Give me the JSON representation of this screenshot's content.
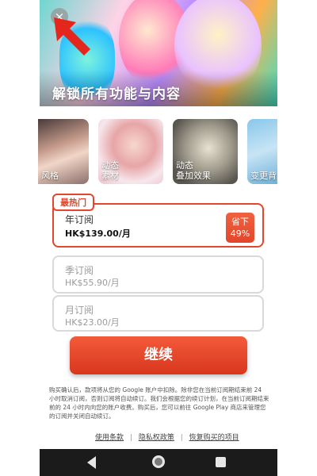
{
  "hero": {
    "title": "解锁所有功能与内容",
    "close_glyph": "×"
  },
  "features": [
    {
      "label": "风格"
    },
    {
      "label": "动态\n素材"
    },
    {
      "label": "动态\n叠加效果"
    },
    {
      "label": "变更背"
    }
  ],
  "plans": {
    "badge": "最热门",
    "annual": {
      "name": "年订阅",
      "price": "HK$139.00/月",
      "save_line1": "省下",
      "save_line2": "49%"
    },
    "quarterly": {
      "name": "季订阅",
      "price": "HK$55.90/月"
    },
    "monthly": {
      "name": "月订阅",
      "price": "HK$23.00/月"
    }
  },
  "continue_label": "继续",
  "terms_text": "购买确认后，款项将从您的 Google 账户中扣除。除非您在当前订阅期结束前 24 小时取消订阅，否则订阅将自动续订。我们会根据您的续订计划，在当前订阅期结束前的 24 小时内向您的账户收费。购买后，您可以前往 Google Play 商店来管理您的订阅并关闭自动续订。",
  "links": {
    "terms": "使用条款",
    "privacy": "隐私权政策",
    "restore": "恢复购买的项目",
    "separator": "|"
  },
  "colors": {
    "accent": "#e2462c",
    "navbar": "#1b1b1b"
  },
  "icons": {
    "close": "close-icon",
    "back": "back-triangle-icon",
    "home": "home-circle-icon",
    "recent": "recent-apps-square-icon"
  }
}
